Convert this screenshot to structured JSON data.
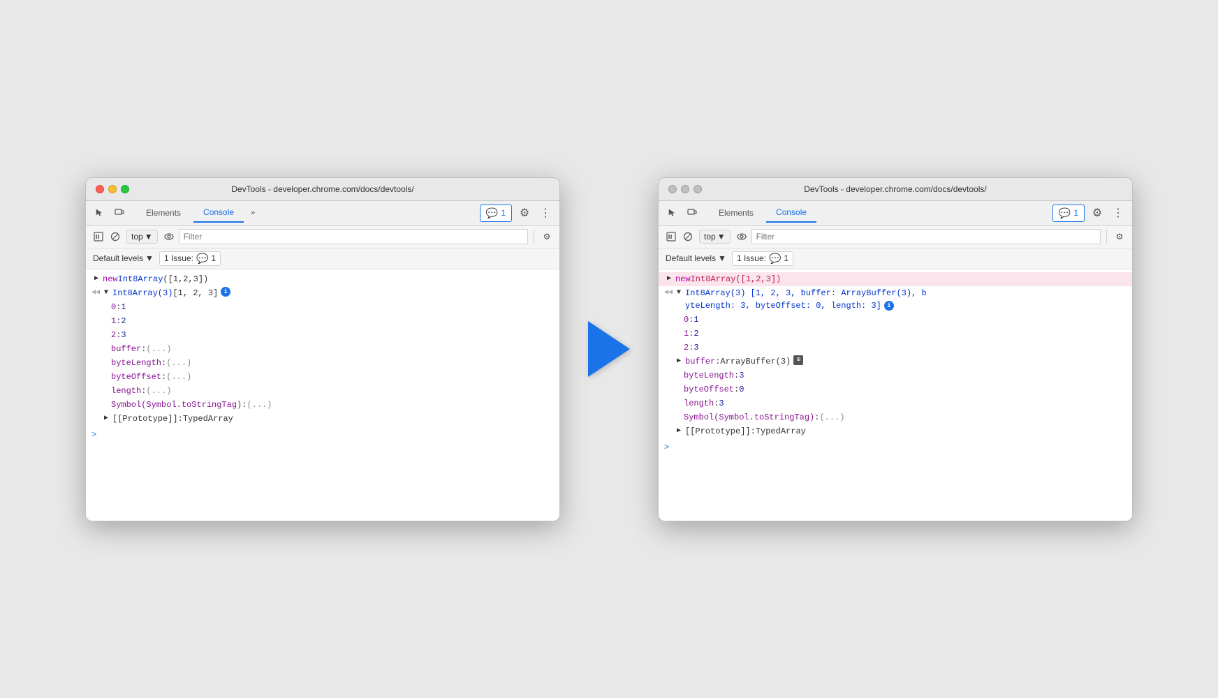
{
  "window_title": "DevTools - developer.chrome.com/docs/devtools/",
  "tabs": {
    "elements": "Elements",
    "console": "Console",
    "more": "»"
  },
  "badge": {
    "count": "1",
    "label": "1"
  },
  "toolbar": {
    "top_label": "top",
    "filter_placeholder": "Filter",
    "default_levels": "Default levels",
    "issue_label": "1 Issue:",
    "issue_count": "1"
  },
  "left_console": {
    "line1": {
      "keyword": "new ",
      "class": "Int8Array",
      "args": "([1,2,3])"
    },
    "line2": {
      "class": "Int8Array(3)",
      "values": " [1, 2, 3] "
    },
    "items": [
      {
        "key": "0",
        "val": "1"
      },
      {
        "key": "1",
        "val": "2"
      },
      {
        "key": "2",
        "val": "3"
      }
    ],
    "props": [
      "buffer: (...)",
      "byteLength: (...)",
      "byteOffset: (...)",
      "length: (...)",
      "Symbol(Symbol.toStringTag): (...)"
    ],
    "prototype": "[[Prototype]]: TypedArray"
  },
  "right_console": {
    "line1": {
      "keyword": "new ",
      "class": "Int8Array",
      "args": "([1,2,3])"
    },
    "line2_part1": "Int8Array(3) [1, 2, 3, buffer: ArrayBuffer(3), b",
    "line2_part2": "yteLength: 3, byteOffset: 0, length: 3]",
    "items": [
      {
        "key": "0",
        "val": "1"
      },
      {
        "key": "1",
        "val": "2"
      },
      {
        "key": "2",
        "val": "3"
      }
    ],
    "buffer_line": "buffer: ArrayBuffer(3)",
    "props": [
      "byteLength: 3",
      "byteOffset: 0",
      "length: 3",
      "Symbol(Symbol.toStringTag): (...)"
    ],
    "prototype": "[[Prototype]]: TypedArray"
  }
}
